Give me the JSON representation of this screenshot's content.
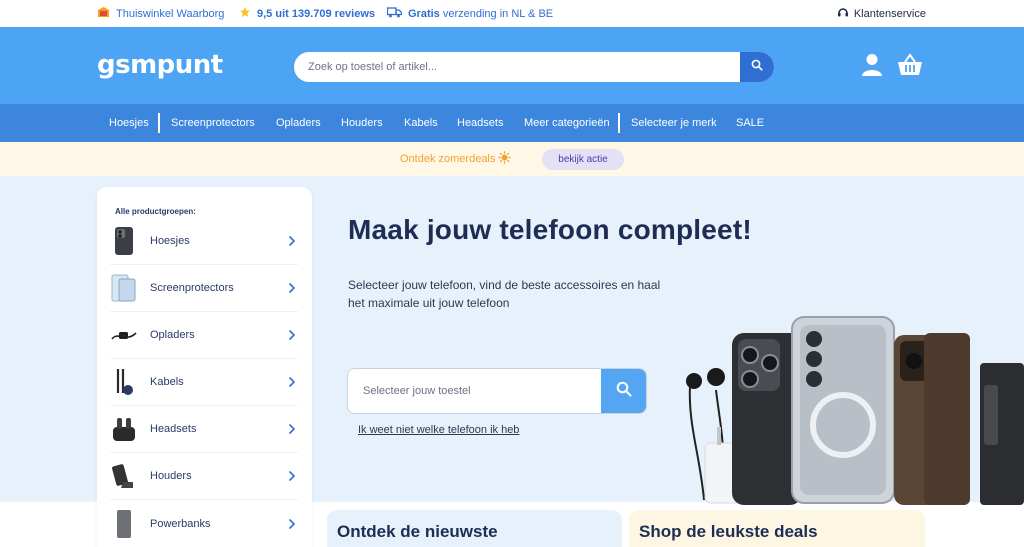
{
  "usp": {
    "waarborg": "Thuiswinkel Waarborg",
    "reviews_score": "9,5 uit 139.709 reviews",
    "shipping_bold": "Gratis",
    "shipping_rest": "verzending in NL & BE",
    "customer_service": "Klantenservice"
  },
  "header": {
    "logo": "gsmpunt",
    "search_placeholder": "Zoek op toestel of artikel..."
  },
  "nav": {
    "items": [
      "Hoesjes",
      "Screenprotectors",
      "Opladers",
      "Houders",
      "Kabels",
      "Headsets",
      "Meer categorieën",
      "Selecteer je merk",
      "SALE"
    ]
  },
  "promo": {
    "text": "Ontdek zomerdeals",
    "button": "bekijk actie"
  },
  "sidebar": {
    "heading": "Alle productgroepen:",
    "items": [
      {
        "label": "Hoesjes"
      },
      {
        "label": "Screenprotectors"
      },
      {
        "label": "Opladers"
      },
      {
        "label": "Kabels"
      },
      {
        "label": "Headsets"
      },
      {
        "label": "Houders"
      },
      {
        "label": "Powerbanks"
      }
    ]
  },
  "hero": {
    "title": "Maak jouw telefoon compleet!",
    "subtitle": "Selecteer jouw telefoon, vind de beste accessoires en haal het maximale uit jouw telefoon",
    "device_placeholder": "Selecteer jouw toestel",
    "unknown_phone_link": "Ik weet niet welke telefoon ik heb"
  },
  "cards": {
    "card1_title": "Ontdek de nieuwste",
    "card2_title": "Shop de leukste deals"
  },
  "colors": {
    "header_blue": "#4da3f4",
    "nav_blue": "#3d86dd",
    "hero_bg": "#e6f1fb",
    "promo_bg": "#fff8e6",
    "accent": "#2f6fd3"
  }
}
